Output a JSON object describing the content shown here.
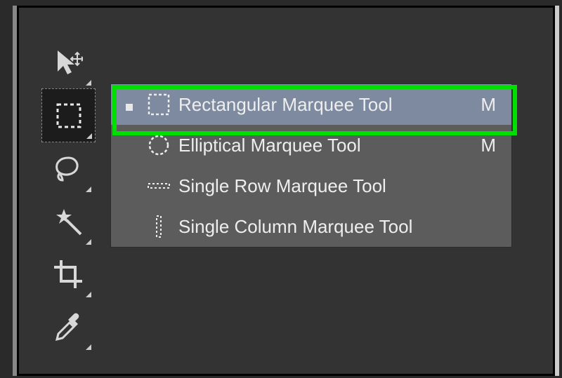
{
  "flyout": {
    "items": [
      {
        "label": "Rectangular Marquee Tool",
        "shortcut": "M"
      },
      {
        "label": "Elliptical Marquee Tool",
        "shortcut": "M"
      },
      {
        "label": "Single Row Marquee Tool",
        "shortcut": ""
      },
      {
        "label": "Single Column Marquee Tool",
        "shortcut": ""
      }
    ]
  }
}
